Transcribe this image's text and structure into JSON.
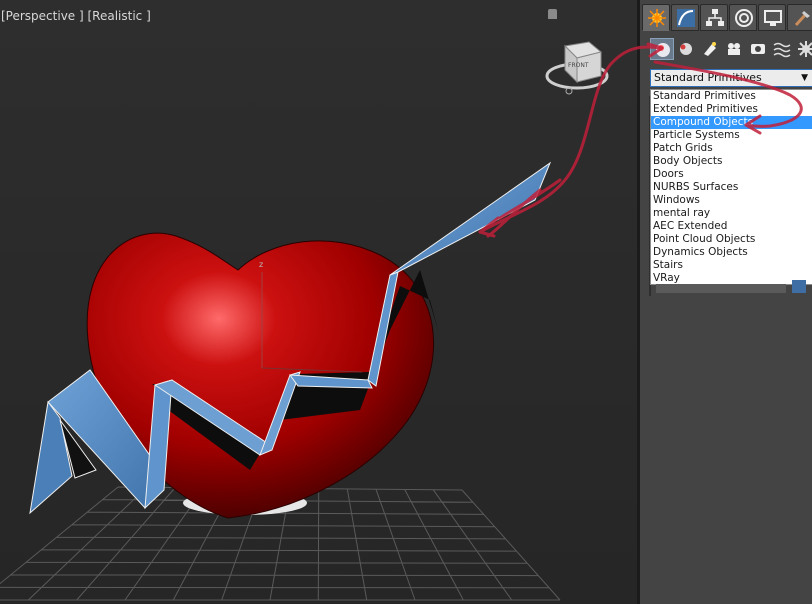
{
  "viewport": {
    "label": "[Perspective ] [Realistic ]",
    "viewcube_face": "FRONT",
    "axis_label": "z"
  },
  "command_panel": {
    "tabs": [
      {
        "name": "create",
        "icon": "create-tab-icon",
        "active": true
      },
      {
        "name": "modify",
        "icon": "modify-tab-icon",
        "active": false
      },
      {
        "name": "hierarchy",
        "icon": "hierarchy-tab-icon",
        "active": false
      },
      {
        "name": "motion",
        "icon": "motion-tab-icon",
        "active": false
      },
      {
        "name": "display",
        "icon": "display-tab-icon",
        "active": false
      },
      {
        "name": "utilities",
        "icon": "utilities-tab-icon",
        "active": false
      }
    ],
    "subtypes": [
      {
        "name": "geometry",
        "icon": "geometry-icon",
        "active": true
      },
      {
        "name": "shapes",
        "icon": "shapes-icon",
        "active": false
      },
      {
        "name": "lights",
        "icon": "lights-icon",
        "active": false
      },
      {
        "name": "cameras",
        "icon": "cameras-icon",
        "active": false
      },
      {
        "name": "helpers",
        "icon": "helpers-icon",
        "active": false
      },
      {
        "name": "space-warps",
        "icon": "space-warps-icon",
        "active": false
      },
      {
        "name": "systems",
        "icon": "systems-icon",
        "active": false
      }
    ],
    "category_select": {
      "value": "Standard Primitives",
      "options": [
        "Standard Primitives",
        "Extended Primitives",
        "Compound Objects",
        "Particle Systems",
        "Patch Grids",
        "Body Objects",
        "Doors",
        "NURBS Surfaces",
        "Windows",
        "mental ray",
        "AEC Extended",
        "Point Cloud Objects",
        "Dynamics Objects",
        "Stairs",
        "VRay"
      ],
      "highlighted": "Compound Objects"
    }
  },
  "colors": {
    "heart": "#b00000",
    "ribbon": "#5a8ec4",
    "annotation": "#c0203a",
    "selection": "#3399ff"
  }
}
